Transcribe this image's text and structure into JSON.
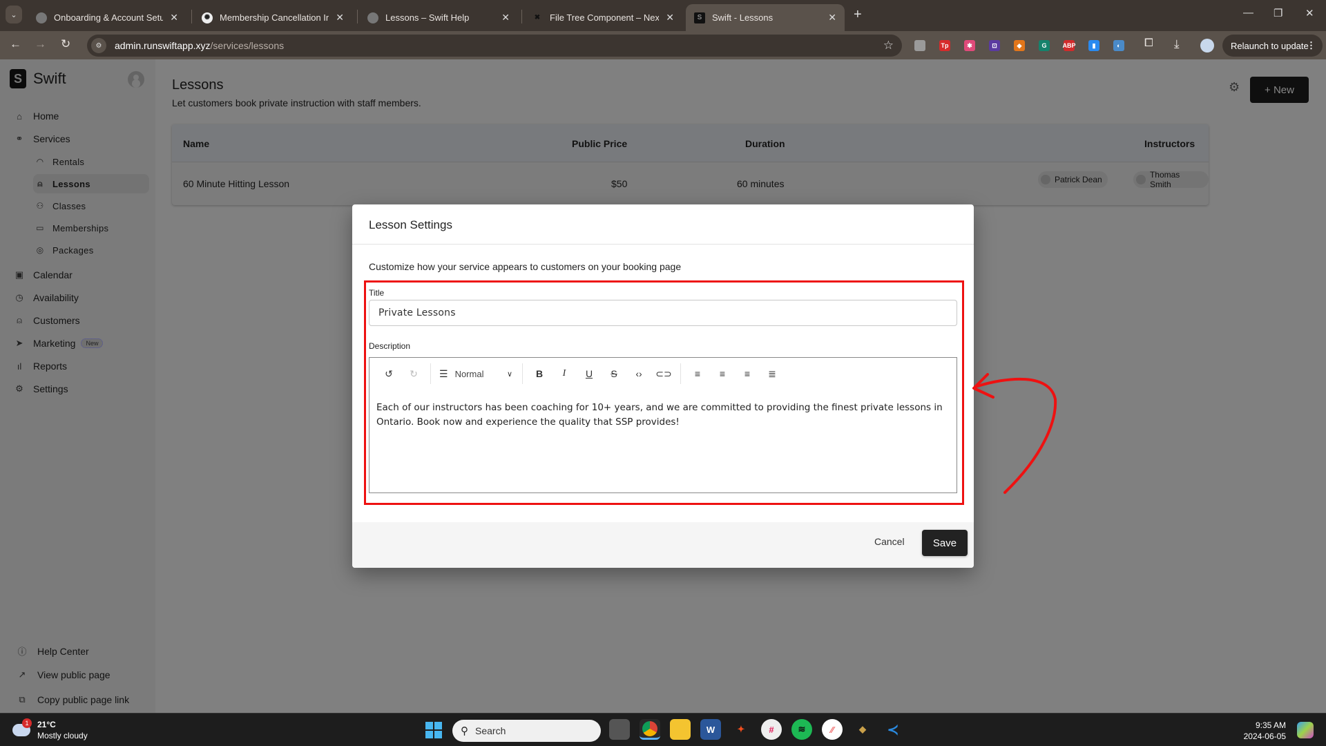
{
  "browser": {
    "tabs": [
      {
        "title": "Onboarding & Account Setup -",
        "active": false
      },
      {
        "title": "Membership Cancellation Instru",
        "active": false
      },
      {
        "title": "Lessons – Swift Help",
        "active": false
      },
      {
        "title": "File Tree Component – Nextra",
        "active": false
      },
      {
        "title": "Swift - Lessons",
        "active": true
      }
    ],
    "url_host": "admin.runswiftapp.xyz",
    "url_path": "/services/lessons",
    "relaunch_label": "Relaunch to update",
    "extensions": [
      {
        "name": "ext-gray",
        "glyph": "",
        "color": "#9a9a9a"
      },
      {
        "name": "ext-tp",
        "glyph": "Tp",
        "color": "#d62b2b"
      },
      {
        "name": "ext-pink",
        "glyph": "✱",
        "color": "#e04a7a"
      },
      {
        "name": "ext-purple",
        "glyph": "⊡",
        "color": "#5a3aa0"
      },
      {
        "name": "ext-metamask",
        "glyph": "◆",
        "color": "#e2761b"
      },
      {
        "name": "ext-grammarly",
        "glyph": "G",
        "color": "#15826c"
      },
      {
        "name": "ext-abp",
        "glyph": "ABP",
        "color": "#d12b2b"
      },
      {
        "name": "ext-blue",
        "glyph": "▮",
        "color": "#2a8af0"
      },
      {
        "name": "ext-lock",
        "glyph": "◐",
        "color": "#4a8ac8"
      }
    ]
  },
  "app": {
    "brand": "Swift",
    "brand_mark": "S",
    "nav": [
      {
        "label": "Home",
        "icon": "⌂"
      },
      {
        "label": "Services",
        "icon": "🔗"
      }
    ],
    "services_sub": [
      {
        "label": "Rentals",
        "icon": "◠",
        "active": false
      },
      {
        "label": "Lessons",
        "icon": "⚲",
        "active": true
      },
      {
        "label": "Classes",
        "icon": "⚇",
        "active": false
      },
      {
        "label": "Memberships",
        "icon": "▭",
        "active": false
      },
      {
        "label": "Packages",
        "icon": "◎",
        "active": false
      }
    ],
    "nav_lower": [
      {
        "label": "Calendar",
        "icon": "▣"
      },
      {
        "label": "Availability",
        "icon": "◷"
      },
      {
        "label": "Customers",
        "icon": "⚲"
      },
      {
        "label": "Marketing",
        "icon": "➤",
        "badge": "New"
      },
      {
        "label": "Reports",
        "icon": "▮"
      },
      {
        "label": "Settings",
        "icon": "⚙"
      }
    ],
    "footer_links": [
      {
        "label": "Help Center",
        "icon": "?"
      },
      {
        "label": "View public page",
        "icon": "↗"
      },
      {
        "label": "Copy public page link",
        "icon": "⧉"
      }
    ]
  },
  "page": {
    "title": "Lessons",
    "subtitle": "Let customers book private instruction with staff members.",
    "new_button": "+ New",
    "table": {
      "columns": [
        "Name",
        "Public Price",
        "Duration",
        "Instructors"
      ],
      "rows": [
        {
          "name": "60 Minute Hitting Lesson",
          "price": "$50",
          "duration": "60 minutes",
          "instructors": [
            "Patrick Dean",
            "Thomas Smith"
          ]
        }
      ]
    }
  },
  "modal": {
    "title": "Lesson Settings",
    "description": "Customize how your service appears to customers on your booking page",
    "title_label": "Title",
    "title_value": "Private Lessons",
    "description_label": "Description",
    "toolbar": {
      "block_style": "Normal",
      "undo": "↺",
      "redo": "↻",
      "bold": "B",
      "italic": "I",
      "underline": "U",
      "strike": "S",
      "code": "‹›",
      "link": "⊂⊃",
      "align_left": "≡",
      "align_center": "≡",
      "align_right": "≡",
      "justify": "≣"
    },
    "description_value": "Each of our instructors has been coaching for 10+ years, and we are committed to providing the finest private lessons in Ontario. Book now and experience the quality that SSP provides!",
    "cancel_label": "Cancel",
    "save_label": "Save"
  },
  "annotation": {
    "color": "#ee1111"
  },
  "taskbar": {
    "weather_temp": "21°C",
    "weather_desc": "Mostly cloudy",
    "weather_badge": "1",
    "search_placeholder": "Search",
    "time": "9:35 AM",
    "date": "2024-06-05"
  }
}
